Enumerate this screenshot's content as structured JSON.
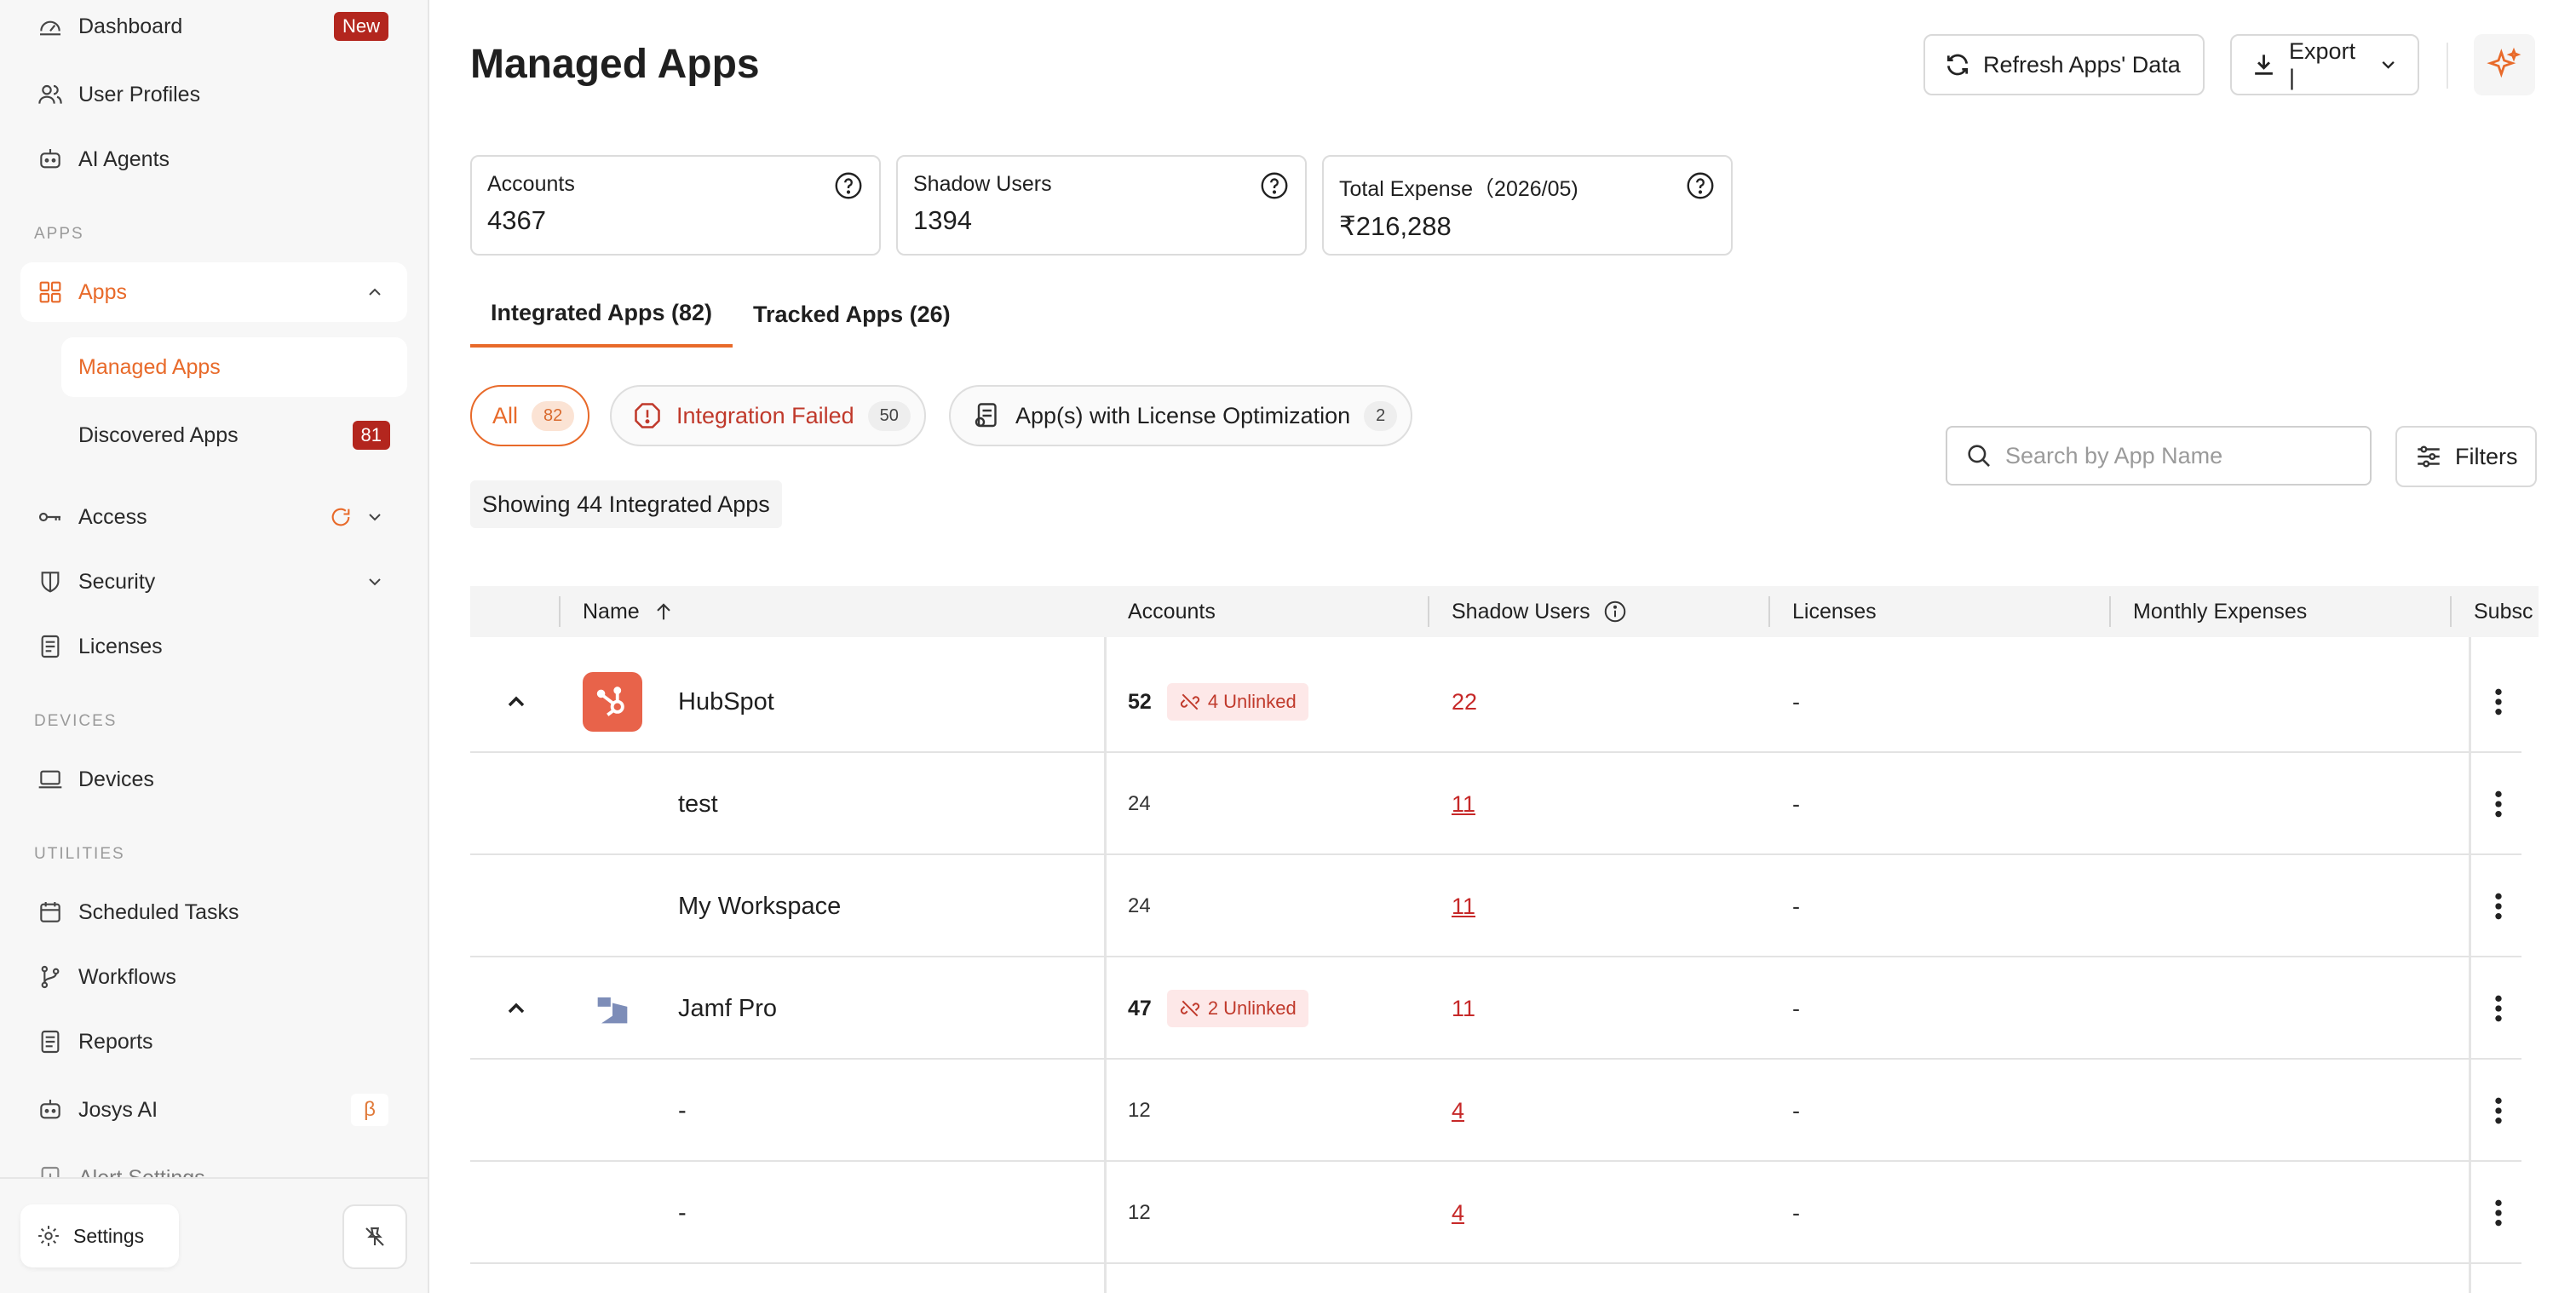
{
  "sidebar": {
    "items_top": [
      {
        "label": "Dashboard",
        "badge": "New"
      },
      {
        "label": "User Profiles"
      },
      {
        "label": "AI Agents"
      }
    ],
    "section_apps": "APPS",
    "apps_label": "Apps",
    "apps_sub": [
      {
        "label": "Managed Apps"
      },
      {
        "label": "Discovered Apps",
        "badge": "81"
      }
    ],
    "access_label": "Access",
    "security_label": "Security",
    "licenses_label": "Licenses",
    "section_devices": "DEVICES",
    "devices_label": "Devices",
    "section_utilities": "UTILITIES",
    "utilities": [
      {
        "label": "Scheduled Tasks"
      },
      {
        "label": "Workflows"
      },
      {
        "label": "Reports"
      },
      {
        "label": "Josys AI",
        "badge": "β"
      },
      {
        "label": "Alert Settings"
      }
    ],
    "settings_label": "Settings"
  },
  "header": {
    "title": "Managed Apps",
    "refresh_label": "Refresh Apps' Data",
    "export_label": "Export |"
  },
  "stats": [
    {
      "label": "Accounts",
      "value": "4367"
    },
    {
      "label": "Shadow Users",
      "value": "1394"
    },
    {
      "label": "Total Expense（2026/05)",
      "value": "₹216,288"
    }
  ],
  "tabs": [
    {
      "label": "Integrated Apps (82)",
      "active": true
    },
    {
      "label": "Tracked Apps (26)",
      "active": false
    }
  ],
  "chips": [
    {
      "label": "All",
      "count": "82",
      "active": true
    },
    {
      "label": "Integration Failed",
      "count": "50"
    },
    {
      "label": "App(s) with License Optimization",
      "count": "2"
    }
  ],
  "showing_text": "Showing 44 Integrated Apps",
  "search": {
    "placeholder": "Search by App Name"
  },
  "filters_label": "Filters",
  "table": {
    "columns": [
      "Name",
      "Accounts",
      "Shadow Users",
      "Licenses",
      "Monthly Expenses",
      "Subsc"
    ],
    "rows": [
      {
        "type": "parent",
        "name": "HubSpot",
        "accounts": "52",
        "unlinked": "4 Unlinked",
        "shadow": "22",
        "licenses": "-"
      },
      {
        "type": "child",
        "name": "test",
        "accounts": "24",
        "shadow": "11",
        "licenses": "-"
      },
      {
        "type": "child",
        "name": "My Workspace",
        "accounts": "24",
        "shadow": "11",
        "licenses": "-"
      },
      {
        "type": "parent",
        "name": "Jamf Pro",
        "accounts": "47",
        "unlinked": "2 Unlinked",
        "shadow": "11",
        "licenses": "-"
      },
      {
        "type": "child",
        "name": "-",
        "accounts": "12",
        "shadow": "4",
        "licenses": "-"
      },
      {
        "type": "child",
        "name": "-",
        "accounts": "12",
        "shadow": "4",
        "licenses": "-"
      }
    ]
  },
  "colors": {
    "accent": "#e86a2a",
    "danger": "#c62828",
    "badge_red": "#b3261e",
    "hubspot": "#e8634a",
    "jamf": "#7d8db8"
  }
}
